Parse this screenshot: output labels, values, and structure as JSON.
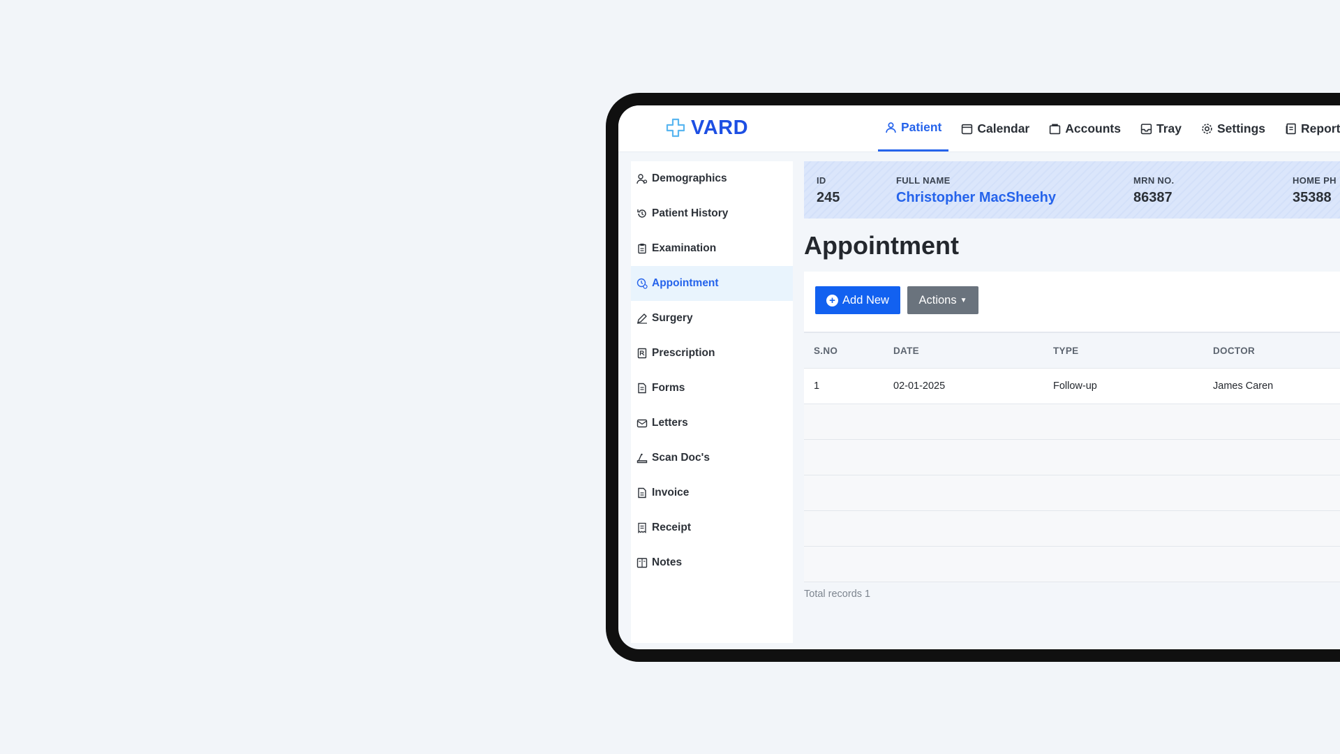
{
  "brand": {
    "name": "VARD",
    "color": "#1d4fe3"
  },
  "nav": [
    {
      "label": "Patient",
      "icon": "user-icon",
      "active": true
    },
    {
      "label": "Calendar",
      "icon": "calendar-icon"
    },
    {
      "label": "Accounts",
      "icon": "accounts-icon"
    },
    {
      "label": "Tray",
      "icon": "tray-icon"
    },
    {
      "label": "Settings",
      "icon": "gear-icon"
    },
    {
      "label": "Reports",
      "icon": "reports-icon"
    }
  ],
  "sidebar": {
    "items": [
      {
        "label": "Demographics",
        "icon": "demographics-icon"
      },
      {
        "label": "Patient History",
        "icon": "history-icon"
      },
      {
        "label": "Examination",
        "icon": "clipboard-icon"
      },
      {
        "label": "Appointment",
        "icon": "appointment-icon",
        "active": true
      },
      {
        "label": "Surgery",
        "icon": "pen-icon"
      },
      {
        "label": "Prescription",
        "icon": "prescription-icon"
      },
      {
        "label": "Forms",
        "icon": "form-icon"
      },
      {
        "label": "Letters",
        "icon": "letter-icon"
      },
      {
        "label": "Scan Doc's",
        "icon": "scan-icon"
      },
      {
        "label": "Invoice",
        "icon": "invoice-icon"
      },
      {
        "label": "Receipt",
        "icon": "receipt-icon"
      },
      {
        "label": "Notes",
        "icon": "notes-icon"
      }
    ]
  },
  "patient": {
    "id_label": "ID",
    "id": "245",
    "name_label": "FULL NAME",
    "name": "Christopher MacSheehy",
    "mrn_label": "MRN NO.",
    "mrn": "86387",
    "phone_label": "HOME PH",
    "phone": "35388"
  },
  "page": {
    "title": "Appointment"
  },
  "toolbar": {
    "add_label": "Add New",
    "actions_label": "Actions"
  },
  "table": {
    "columns": [
      "S.NO",
      "DATE",
      "TYPE",
      "DOCTOR"
    ],
    "rows": [
      [
        "1",
        "02-01-2025",
        "Follow-up",
        "James Caren"
      ]
    ],
    "empty_rows": 5
  },
  "footer": {
    "total": "Total records 1"
  },
  "colors": {
    "accent": "#2563eb",
    "active_bg": "#e9f4fd",
    "banner": "#dbe6fb"
  }
}
